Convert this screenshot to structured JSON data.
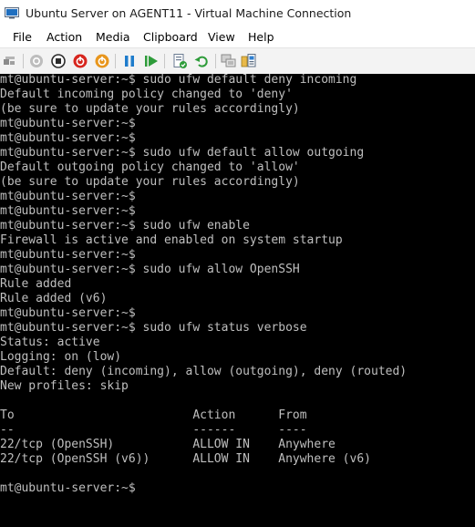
{
  "window": {
    "title": "Ubuntu Server on AGENT11 - Virtual Machine Connection"
  },
  "menu": {
    "items": [
      "File",
      "Action",
      "Media",
      "Clipboard",
      "View",
      "Help"
    ]
  },
  "toolbar": {
    "buttons": [
      {
        "icon": "ctrl-alt-del-icon"
      },
      {
        "icon": "start-icon"
      },
      {
        "icon": "turn-off-icon"
      },
      {
        "icon": "shut-down-icon"
      },
      {
        "icon": "save-state-icon"
      },
      {
        "icon": "pause-icon"
      },
      {
        "icon": "resume-icon"
      },
      {
        "icon": "checkpoint-icon"
      },
      {
        "icon": "revert-icon"
      },
      {
        "icon": "enhanced-session-icon"
      },
      {
        "icon": "share-icon"
      }
    ]
  },
  "console": {
    "lines": [
      "mt@ubuntu-server:~$ sudo ufw default deny incoming",
      "Default incoming policy changed to 'deny'",
      "(be sure to update your rules accordingly)",
      "mt@ubuntu-server:~$",
      "mt@ubuntu-server:~$",
      "mt@ubuntu-server:~$ sudo ufw default allow outgoing",
      "Default outgoing policy changed to 'allow'",
      "(be sure to update your rules accordingly)",
      "mt@ubuntu-server:~$",
      "mt@ubuntu-server:~$",
      "mt@ubuntu-server:~$ sudo ufw enable",
      "Firewall is active and enabled on system startup",
      "mt@ubuntu-server:~$",
      "mt@ubuntu-server:~$ sudo ufw allow OpenSSH",
      "Rule added",
      "Rule added (v6)",
      "mt@ubuntu-server:~$",
      "mt@ubuntu-server:~$ sudo ufw status verbose",
      "Status: active",
      "Logging: on (low)",
      "Default: deny (incoming), allow (outgoing), deny (routed)",
      "New profiles: skip",
      "",
      "To                         Action      From",
      "--                         ------      ----",
      "22/tcp (OpenSSH)           ALLOW IN    Anywhere",
      "22/tcp (OpenSSH (v6))      ALLOW IN    Anywhere (v6)",
      "",
      "mt@ubuntu-server:~$"
    ]
  }
}
